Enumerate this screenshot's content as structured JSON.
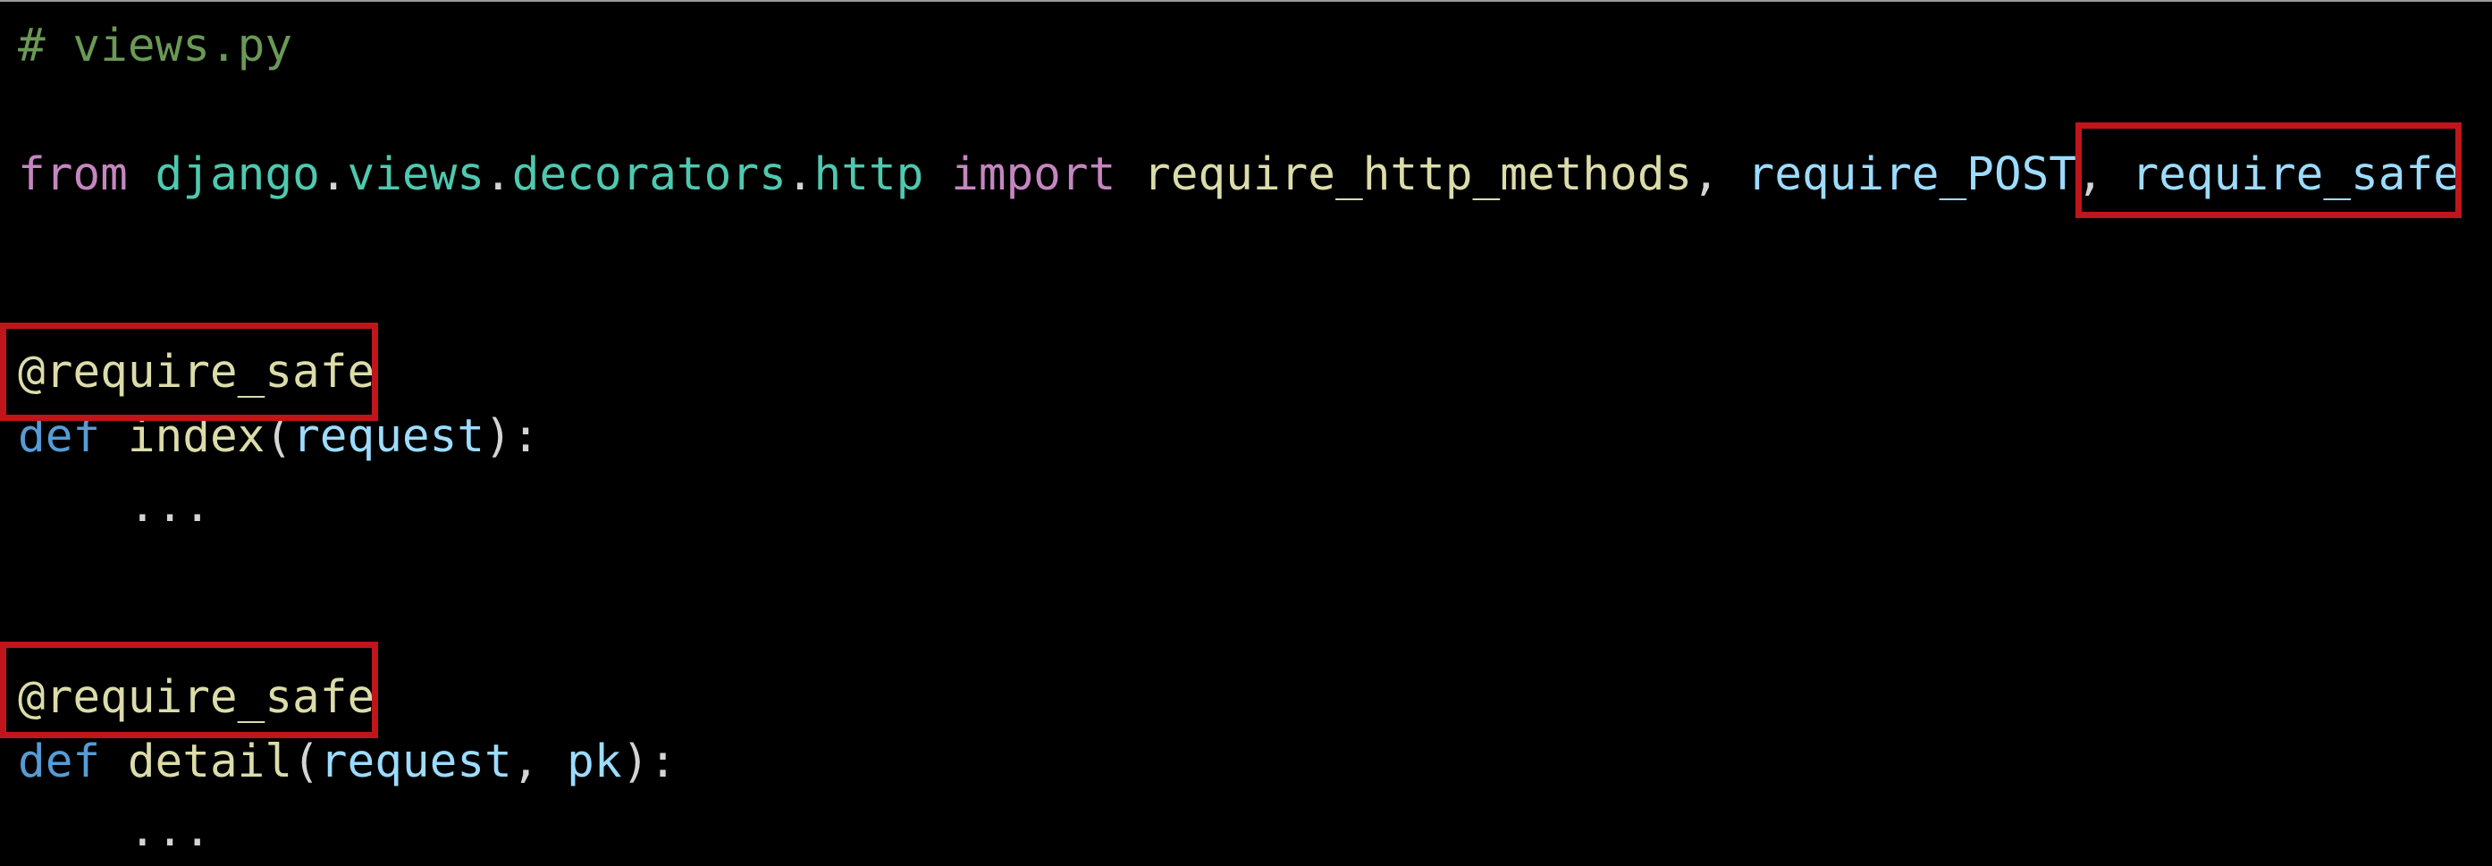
{
  "code": {
    "comment": "# views.py",
    "import_line": {
      "from_kw": "from",
      "module_parts": [
        "django",
        "views",
        "decorators",
        "http"
      ],
      "dot": ".",
      "import_kw": "import",
      "name_1": "require_http_methods",
      "name_2": "require_POST",
      "name_3": "require_safe",
      "comma": ","
    },
    "block_1": {
      "decorator": "@require_safe",
      "def_kw": "def",
      "func_name": "index",
      "open_paren": "(",
      "params": "request",
      "close": "):",
      "body": "..."
    },
    "block_2": {
      "decorator": "@require_safe",
      "def_kw": "def",
      "func_name": "detail",
      "open_paren": "(",
      "param_1": "request",
      "comma": ",",
      "param_2": "pk",
      "close": "):",
      "body": "..."
    }
  },
  "colors": {
    "background": "#000000",
    "comment": "#6a9955",
    "keyword": "#c586c0",
    "module": "#4ec9b0",
    "function": "#dcdcaa",
    "name": "#9cdcfe",
    "def_keyword": "#569cd6",
    "highlight_border": "#c0151b"
  }
}
